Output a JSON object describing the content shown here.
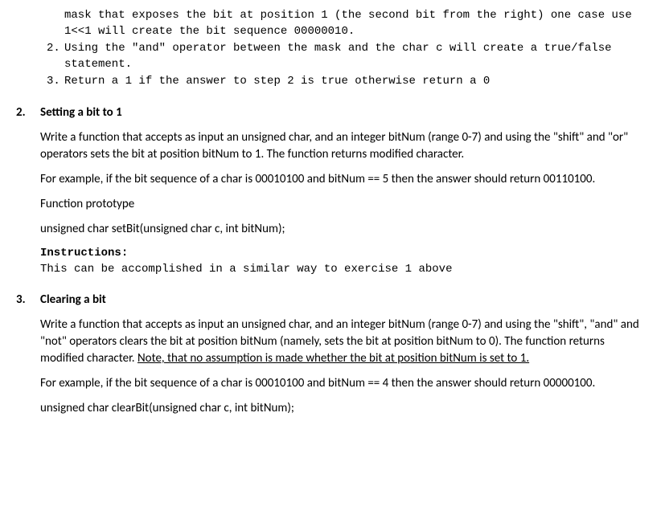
{
  "top_sublist": {
    "item1_cont": "mask that exposes the bit at position 1 (the second bit from the right) one case use 1<<1 will create the bit sequence 00000010.",
    "item2_num": "2.",
    "item2_text": "Using the \"and\" operator between the mask and the char c will create a true/false statement.",
    "item3_num": "3.",
    "item3_text": "Return a 1 if the answer to step 2 is true otherwise return a 0"
  },
  "section2": {
    "num": "2.",
    "title": "Setting a bit to 1",
    "p1": "Write a function that accepts as input an unsigned char, and an integer bitNum (range 0-7) and using the \"shift\" and \"or\" operators sets the bit at position bitNum to 1.  The function returns modified character.",
    "p2": "For example, if the bit sequence of a char is 00010100 and bitNum == 5 then the answer should return 00110100.",
    "p3": "Function prototype",
    "p4": "unsigned char setBit(unsigned char c, int bitNum);",
    "instructions_label": "Instructions:",
    "instructions_text": "This can be accomplished in a similar way to exercise 1 above"
  },
  "section3": {
    "num": "3.",
    "title": "Clearing a bit",
    "p1a": "Write a function that accepts as input an unsigned char, and an integer bitNum (range 0-7) and using the \"shift\", \"and\" and \"not\" operators clears the bit at position bitNum (namely, sets the bit at position bitNum to 0).  The function returns modified character.  ",
    "p1b": "Note, that no assumption is made whether the bit at position bitNum is set to 1.",
    "p2": "For example, if the bit sequence of a char is 00010100 and bitNum == 4 then the answer should return 00000100.",
    "p3": "unsigned char clearBit(unsigned char c, int bitNum);"
  }
}
